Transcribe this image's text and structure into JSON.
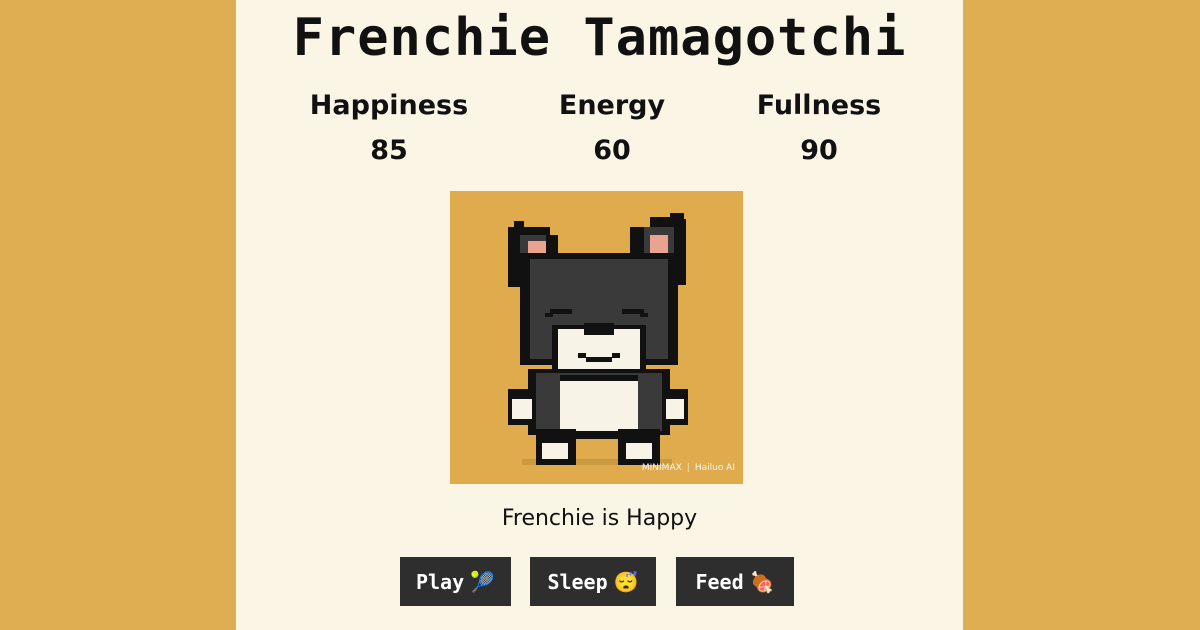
{
  "title": "Frenchie Tamagotchi",
  "stats": [
    {
      "label": "Happiness",
      "value": "85"
    },
    {
      "label": "Energy",
      "value": "60"
    },
    {
      "label": "Fullness",
      "value": "90"
    }
  ],
  "pet_image": {
    "watermark_left": "MINIMAX",
    "watermark_right": "Hailuo AI",
    "background_color": "#e0ab4d"
  },
  "status_text": "Frenchie is Happy",
  "buttons": {
    "play": {
      "label": "Play",
      "emoji": "🎾"
    },
    "sleep": {
      "label": "Sleep",
      "emoji": "😴"
    },
    "feed": {
      "label": "Feed",
      "emoji": "🍖"
    }
  },
  "colors": {
    "page_background": "#deaf52",
    "panel_background": "#fbf5e6",
    "button_background": "#2e2e2e"
  }
}
